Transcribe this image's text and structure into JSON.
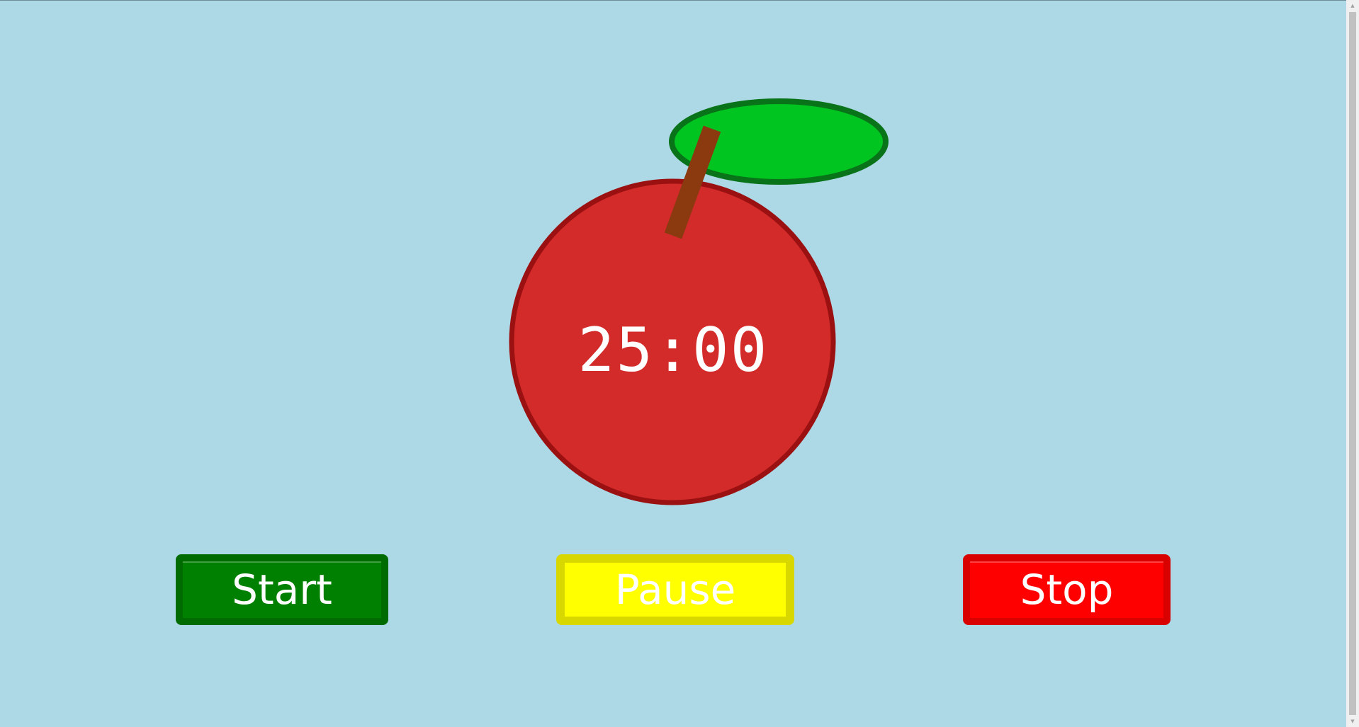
{
  "timer": {
    "display": "25:00"
  },
  "buttons": {
    "start_label": "Start",
    "pause_label": "Pause",
    "stop_label": "Stop"
  },
  "colors": {
    "background": "#add8e6",
    "apple_fill": "#d32a2a",
    "apple_outline": "#9b1111",
    "leaf_fill": "#00c41f",
    "leaf_outline": "#087318",
    "stem": "#8b3a10",
    "start": "#008000",
    "pause": "#ffff00",
    "stop": "#ff0000"
  },
  "icons": {
    "scroll_up": "triangle-up",
    "scroll_down": "triangle-down"
  }
}
